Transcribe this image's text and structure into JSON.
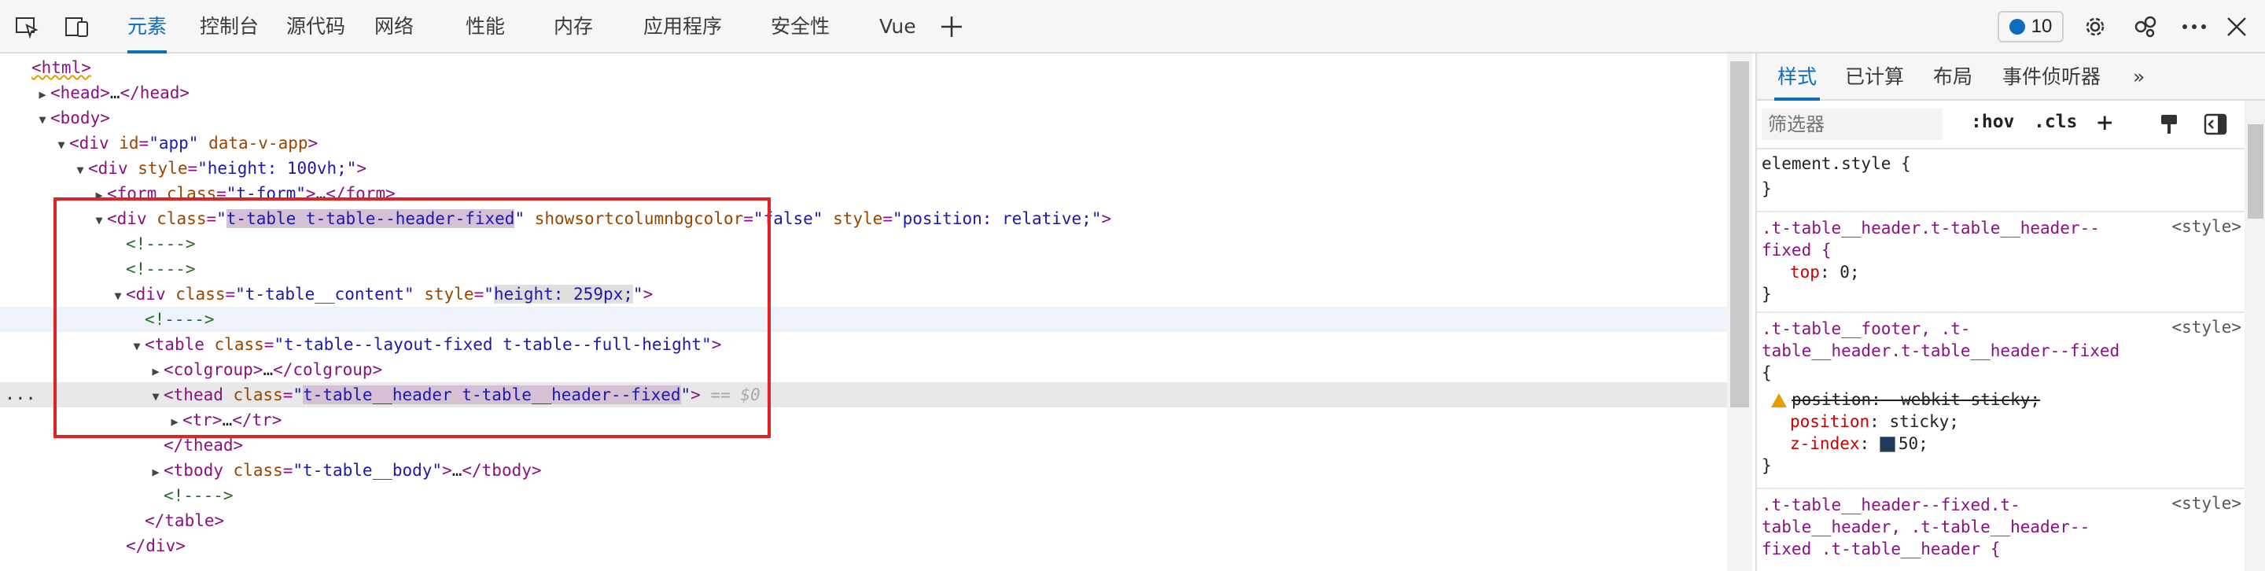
{
  "toolbar": {
    "tabs": [
      "元素",
      "控制台",
      "源代码",
      "网络",
      "性能",
      "内存",
      "应用程序",
      "安全性",
      "Vue"
    ],
    "active_tab": "元素",
    "badge_count": "10",
    "icons": [
      "inspect-icon",
      "device-toolbar-icon",
      "add-tab-icon",
      "settings-icon",
      "connect-icon",
      "more-icon",
      "close-icon"
    ]
  },
  "tree": {
    "gutter_ellipsis": "...",
    "lines": [
      {
        "t": "<html>"
      },
      {
        "t": "<head>…</head>"
      },
      {
        "t": "<body>"
      },
      {
        "t": "<div id=\"app\" data-v-app>"
      },
      {
        "t": "<div style=\"height: 100vh;\">"
      },
      {
        "t": "<form class=\"t-form\">…</form>"
      },
      {
        "t": "<div class=\"t-table t-table--header-fixed\" showsortcolumnbgcolor=\"false\" style=\"position: relative;\">"
      },
      {
        "t": "<!---->"
      },
      {
        "t": "<!---->"
      },
      {
        "t": "<div class=\"t-table__content\" style=\"height: 259px;\">"
      },
      {
        "t": "<!---->"
      },
      {
        "t": "<table class=\"t-table--layout-fixed t-table--full-height\">"
      },
      {
        "t": "<colgroup>…</colgroup>"
      },
      {
        "t": "<thead class=\"t-table__header t-table__header--fixed\"> == $0"
      },
      {
        "t": "<tr>…</tr>"
      },
      {
        "t": "</thead>"
      },
      {
        "t": "<tbody class=\"t-table__body\">…</tbody>"
      },
      {
        "t": "<!---->"
      },
      {
        "t": "</table>"
      },
      {
        "t": "</div>"
      }
    ],
    "parts": {
      "html_open": "<html>",
      "head_open": "<head>",
      "head_ell": "…",
      "head_close": "</head>",
      "body_open": "<body>",
      "div": "div",
      "id_attr": "id",
      "app_val": "\"app\"",
      "data_v_app": "data-v-app",
      "style_attr": "style",
      "h100_val": "\"height: 100vh;\"",
      "form": "form",
      "class_attr": "class",
      "t_form_val": "\"t-form\"",
      "form_close": "</form>",
      "t_table_q1": "\"",
      "t_table_cls": "t-table t-table--header-fixed",
      "t_table_q2": "\"",
      "showsort_attr": "showsortcolumnbgcolor",
      "false_val": "\"false\"",
      "pos_val": "\"position: relative;\"",
      "comment": "<!---->",
      "content_val": "\"t-table__content\"",
      "h259_q1": "\"",
      "h259": "height: 259px;",
      "h259_q2": "\"",
      "table": "table",
      "table_cls": "\"t-table--layout-fixed t-table--full-height\"",
      "colgroup_open": "<colgroup>",
      "colgroup_close": "</colgroup>",
      "thead": "thead",
      "thead_q1": "\"",
      "thead_cls": "t-table__header t-table__header--fixed",
      "thead_q2": "\"",
      "dollar": " == $0",
      "tr_open": "<tr>",
      "tr_close": "</tr>",
      "thead_close": "</thead>",
      "tbody": "tbody",
      "tbody_cls": "\"t-table__body\"",
      "tbody_close": "</tbody>",
      "table_close": "</table>",
      "div_close": "</div>",
      "lt": "<",
      "gt": ">",
      "eq": "=",
      "sp": " "
    }
  },
  "styles_pane": {
    "tabs": [
      "样式",
      "已计算",
      "布局",
      "事件侦听器",
      "»"
    ],
    "active_tab": "样式",
    "filter_placeholder": "筛选器",
    "hov": ":hov",
    "cls": ".cls",
    "add": "+",
    "rules": {
      "r0_l1": "element.style {",
      "r0_l2": "}",
      "r1_sel1": ".t-table__header.t-table__header--",
      "r1_sel2": "fixed {",
      "r1_prop": "top",
      "r1_val": "0;",
      "r1_close": "}",
      "r1_src": "<style>",
      "r2_sel1": ".t-table__footer, .t-",
      "r2_sel2": "table__header.t-table__header--fixed",
      "r2_sel3": "{",
      "r2_p1": "position: -webkit-sticky;",
      "r2_p2_name": "position",
      "r2_p2_val": "sticky;",
      "r2_p3_name": "z-index",
      "r2_p3_val": "50;",
      "r2_close": "}",
      "r2_src": "<style>",
      "r3_sel1": ".t-table__header--fixed.t-",
      "r3_sel2": "table__header, .t-table__header--",
      "r3_sel3": "fixed .t-table__header {",
      "r3_src": "<style>",
      "colon": ": "
    }
  },
  "colors": {
    "accent": "#0f6cbd",
    "highlight_box": "#e02424",
    "tag": "#881280",
    "attr_name": "#994500",
    "attr_value": "#1a1aa6",
    "comment": "#236e25"
  }
}
